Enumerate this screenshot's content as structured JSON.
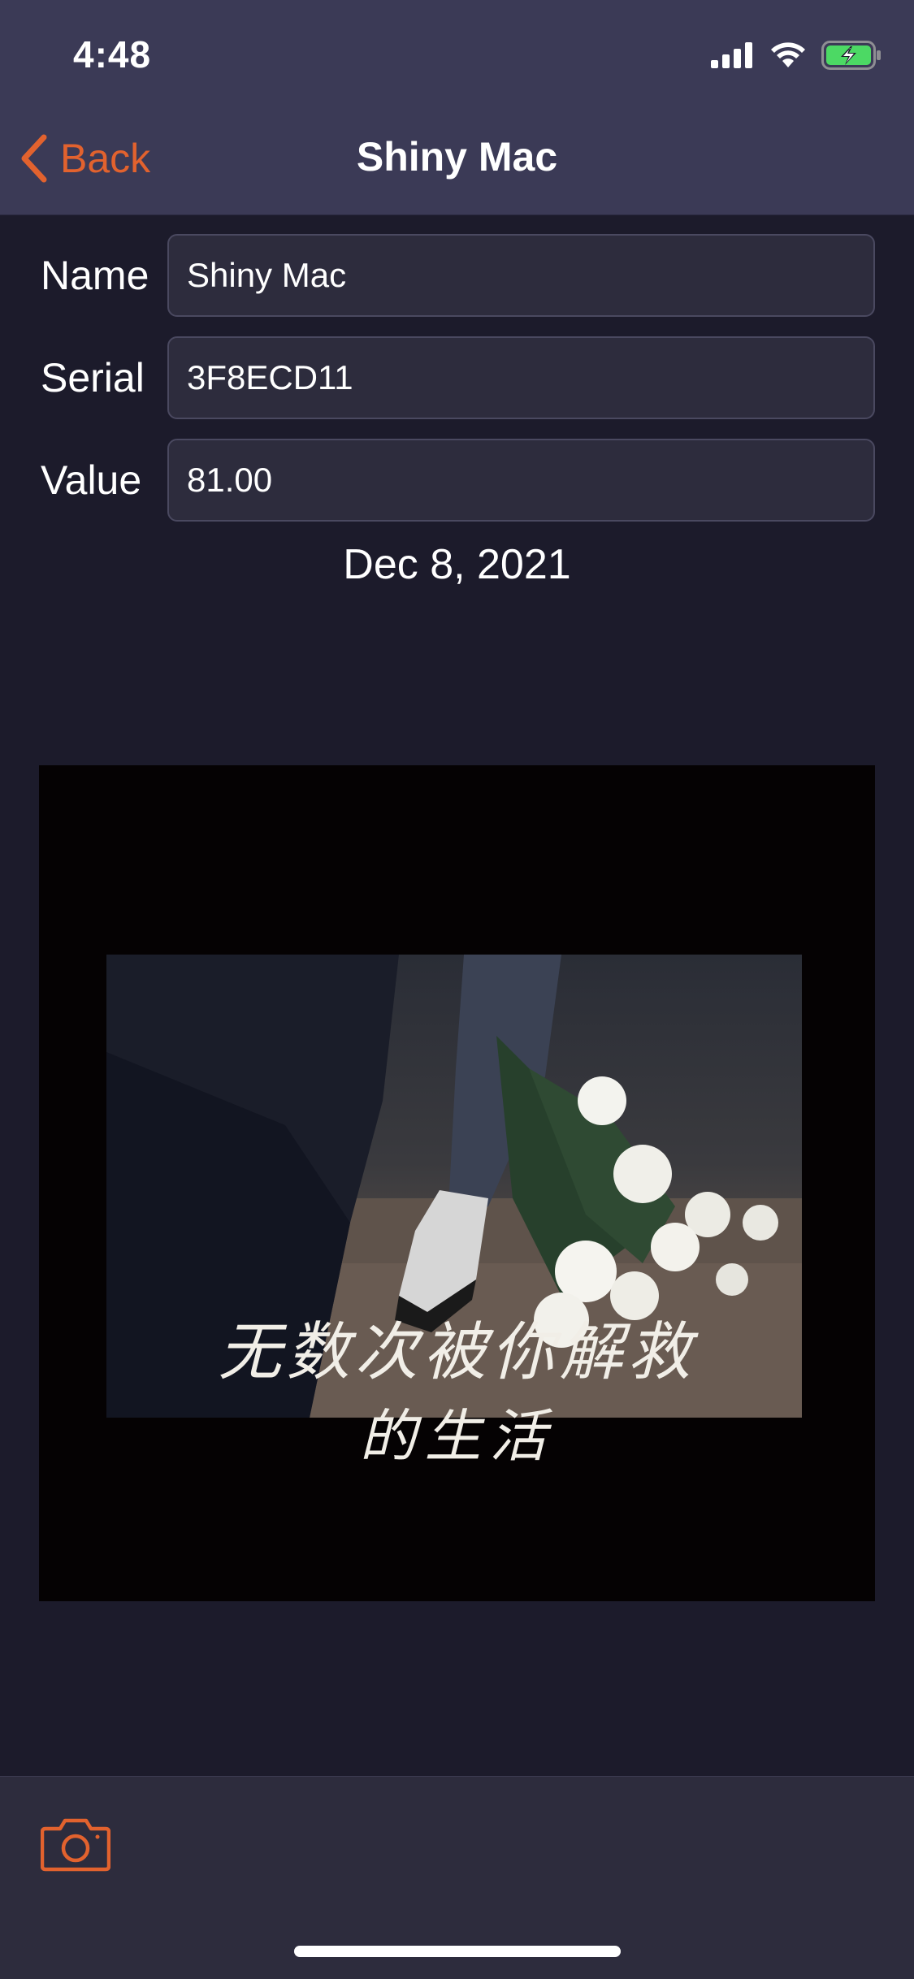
{
  "status_bar": {
    "time": "4:48",
    "icons": [
      "signal-icon",
      "wifi-icon",
      "battery-charging-icon"
    ],
    "battery_color": "#4cd964"
  },
  "nav": {
    "back_label": "Back",
    "title": "Shiny Mac",
    "accent_color": "#e2622e"
  },
  "form": {
    "name": {
      "label": "Name",
      "value": "Shiny Mac"
    },
    "serial": {
      "label": "Serial",
      "value": "3F8ECD11"
    },
    "value": {
      "label": "Value",
      "value": "81.00"
    }
  },
  "date_created": "Dec 8, 2021",
  "photo": {
    "caption_line1": "无数次被你解救",
    "caption_line2": "的生活"
  },
  "toolbar": {
    "camera_icon": "camera-icon"
  }
}
